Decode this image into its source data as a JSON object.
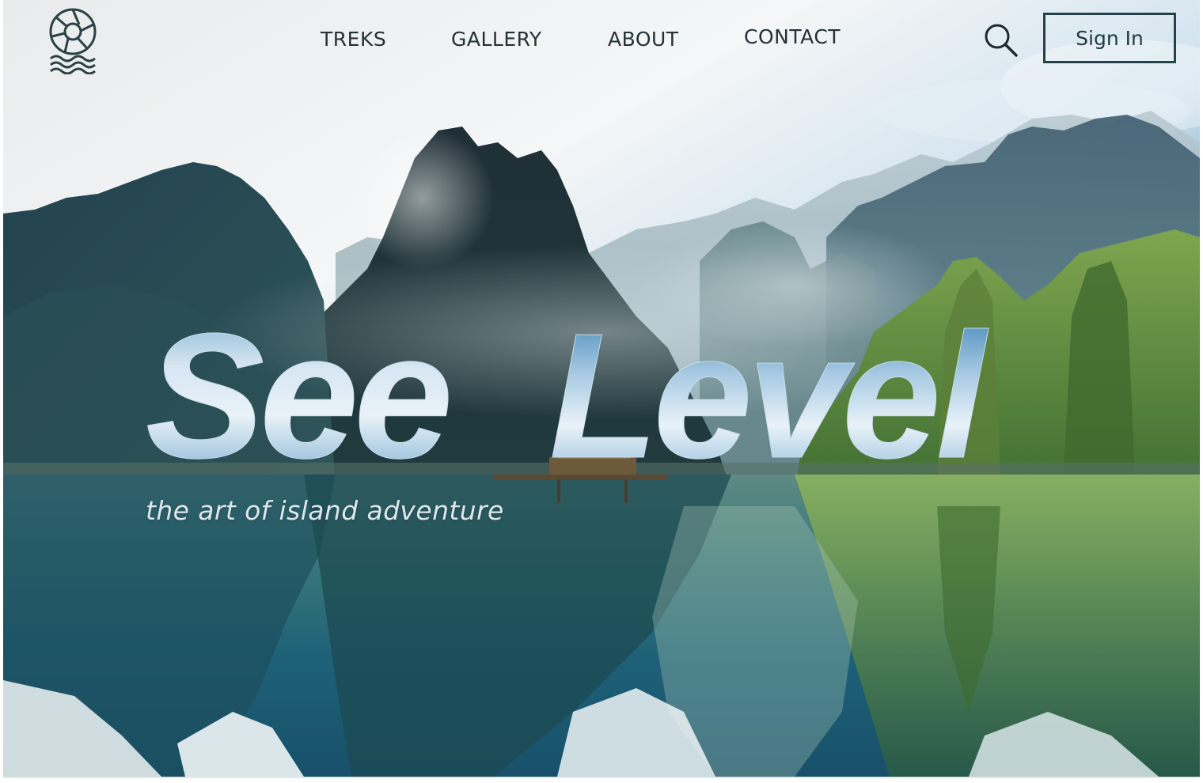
{
  "brand": {
    "logo_icon": "aperture-waves-logo-icon"
  },
  "nav": {
    "items": [
      {
        "label": "TREKS"
      },
      {
        "label": "GALLERY"
      },
      {
        "label": "ABOUT"
      },
      {
        "label": "CONTACT"
      }
    ]
  },
  "header": {
    "search_icon": "search-icon",
    "sign_in_label": "Sign In"
  },
  "hero": {
    "title_word_1": "See",
    "title_word_2": "Level",
    "tagline": "the art of island adventure"
  },
  "colors": {
    "text_dark": "#243238",
    "title_light": "#d9e8f3",
    "title_mid": "#6aa3c8",
    "title_deep": "#2d76a8",
    "water": "#1d5f72"
  }
}
